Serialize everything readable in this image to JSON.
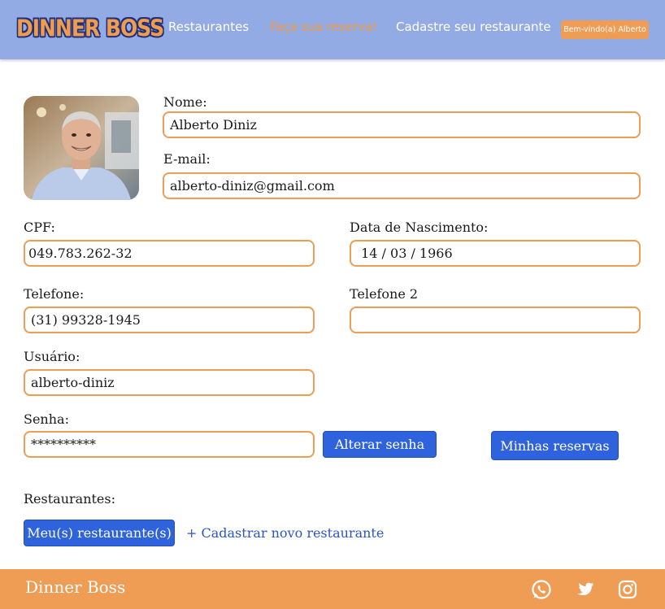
{
  "header": {
    "logo": "DINNER BOSS",
    "nav": [
      "Restaurantes",
      "Faça sua reserva!",
      "Cadastre seu restaurante"
    ],
    "welcome": "Bem-vindo(a) Alberto"
  },
  "profile": {
    "avatar_icon": "user-photo",
    "nome_label": "Nome:",
    "nome_value": "Alberto Diniz",
    "email_label": "E-mail:",
    "email_value": "alberto-diniz@gmail.com",
    "cpf_label": "CPF:",
    "cpf_value": "049.783.262-32",
    "nascimento_label": "Data de Nascimento:",
    "nascimento_value": " 14 / 03 / 1966",
    "telefone_label": "Telefone:",
    "telefone_value": "(31) 99328-1945",
    "telefone2_label": "Telefone 2",
    "telefone2_value": "",
    "usuario_label": "Usuário:",
    "usuario_value": "alberto-diniz",
    "senha_label": "Senha:",
    "senha_value": "**********",
    "alterar_senha": "Alterar senha",
    "minhas_reservas": "Minhas reservas"
  },
  "restaurantes": {
    "label": "Restaurantes:",
    "meus_button": "Meu(s) restaurante(s)",
    "cadastrar_link": "+ Cadastrar novo restaurante"
  },
  "footer": {
    "brand": "Dinner Boss",
    "icons": [
      "whatsapp-icon",
      "twitter-icon",
      "instagram-icon"
    ]
  },
  "colors": {
    "header_bg": "#93abe4",
    "accent_orange": "#ef9c55",
    "button_blue": "#2f63de",
    "link_blue": "#2a55c9"
  }
}
